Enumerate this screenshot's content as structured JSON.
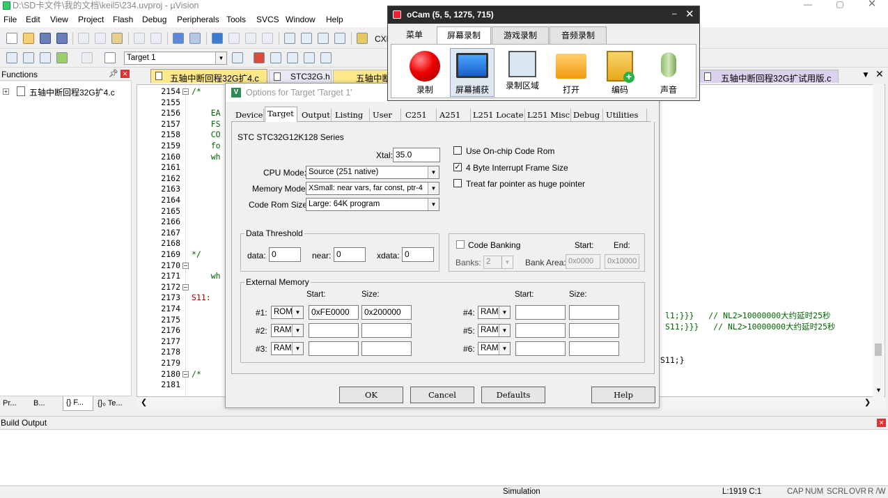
{
  "window": {
    "title": "D:\\SD卡文件\\我的文档\\keil5\\234.uvproj - µVision"
  },
  "menu": [
    "File",
    "Edit",
    "View",
    "Project",
    "Flash",
    "Debug",
    "Peripherals",
    "Tools",
    "SVCS",
    "Window",
    "Help"
  ],
  "toolbar": {
    "cxf": "CXF",
    "target_select": "Target 1"
  },
  "functions_panel": {
    "title": "Functions",
    "tree_item": "五轴中断回程32G扩4.c",
    "bottom_tabs": [
      "Pr...",
      "B...",
      "{} F...",
      "{}₀ Te..."
    ]
  },
  "editor_tabs": [
    "五轴中断回程32G扩4.c",
    "STC32G.h",
    "五轴中断",
    "五轴中断回程32G扩试用版.c"
  ],
  "code_lines": [
    {
      "n": "2154",
      "t": "/*",
      "c": false
    },
    {
      "n": "2155",
      "t": "",
      "c": false
    },
    {
      "n": "2156",
      "t": "    EA",
      "c": false
    },
    {
      "n": "2157",
      "t": "    FS",
      "c": false
    },
    {
      "n": "2158",
      "t": "    CO",
      "c": false
    },
    {
      "n": "2159",
      "t": "    fo",
      "c": false
    },
    {
      "n": "2160",
      "t": "    wh",
      "c": false
    },
    {
      "n": "2161",
      "t": "",
      "c": false
    },
    {
      "n": "2162",
      "t": "",
      "c": false
    },
    {
      "n": "2163",
      "t": "",
      "c": false
    },
    {
      "n": "2164",
      "t": "",
      "c": false
    },
    {
      "n": "2165",
      "t": "",
      "c": false
    },
    {
      "n": "2166",
      "t": "",
      "c": false
    },
    {
      "n": "2167",
      "t": "",
      "c": false
    },
    {
      "n": "2168",
      "t": "",
      "c": false
    },
    {
      "n": "2169",
      "t": "*/",
      "c": false
    },
    {
      "n": "2170",
      "t": "",
      "c": false
    },
    {
      "n": "2171",
      "t": "    wh",
      "c": false
    },
    {
      "n": "2172",
      "t": "",
      "c": false
    },
    {
      "n": "2173",
      "t": "S11:",
      "c": false
    },
    {
      "n": "2174",
      "t": "",
      "c": false
    },
    {
      "n": "2175",
      "t": "",
      "c": false
    },
    {
      "n": "2176",
      "t": "",
      "c": false
    },
    {
      "n": "2177",
      "t": "",
      "c": false
    },
    {
      "n": "2178",
      "t": "",
      "c": false
    },
    {
      "n": "2179",
      "t": "",
      "c": false
    },
    {
      "n": "2180",
      "t": "/*",
      "c": false
    },
    {
      "n": "2181",
      "t": "",
      "c": false
    }
  ],
  "code_right": [
    "l1;}}}   // NL2>10000000大约延时25秒",
    "S11;}}}   // NL2>10000000大约延时25秒",
    "S11;}"
  ],
  "build_output": {
    "title": "Build Output"
  },
  "status": {
    "mode": "Simulation",
    "pos": "L:1919 C:1",
    "caps": "CAP",
    "num": "NUM",
    "scrl": "SCRL",
    "ovr": "OVR",
    "rw": "R /W"
  },
  "dialog": {
    "title": "Options for Target 'Target 1'",
    "tabs": [
      "Device",
      "Target",
      "Output",
      "Listing",
      "User",
      "C251",
      "A251",
      "L251 Locate",
      "L251 Misc",
      "Debug",
      "Utilities"
    ],
    "device": "STC STC32G12K128 Series",
    "xtal_label": "Xtal:",
    "xtal": "35.0",
    "cpu_mode_label": "CPU Mode:",
    "cpu_mode": "Source (251 native)",
    "memory_model_label": "Memory Model:",
    "memory_model": "XSmall: near vars, far const, ptr-4",
    "code_rom_label": "Code Rom Size:",
    "code_rom": "Large: 64K program",
    "opt_onchip": "Use On-chip Code Rom",
    "opt_4byte": "4 Byte Interrupt Frame Size",
    "opt_far": "Treat far pointer as huge pointer",
    "data_threshold": {
      "legend": "Data Threshold",
      "data_label": "data:",
      "data": "0",
      "near_label": "near:",
      "near": "0",
      "xdata_label": "xdata:",
      "xdata": "0"
    },
    "banking": {
      "label": "Code Banking",
      "banks_label": "Banks:",
      "banks": "2",
      "area_label": "Bank Area:",
      "start_label": "Start:",
      "end_label": "End:",
      "start": "0x0000",
      "end": "0x10000"
    },
    "ext": {
      "legend": "External Memory",
      "start_label": "Start:",
      "size_label": "Size:",
      "rows_left": [
        {
          "id": "#1:",
          "type": "ROM",
          "start": "0xFE0000",
          "size": "0x200000"
        },
        {
          "id": "#2:",
          "type": "RAM",
          "start": "",
          "size": ""
        },
        {
          "id": "#3:",
          "type": "RAM",
          "start": "",
          "size": ""
        }
      ],
      "rows_right": [
        {
          "id": "#4:",
          "type": "RAM",
          "start": "",
          "size": ""
        },
        {
          "id": "#5:",
          "type": "RAM",
          "start": "",
          "size": ""
        },
        {
          "id": "#6:",
          "type": "RAM",
          "start": "",
          "size": ""
        }
      ]
    },
    "buttons": {
      "ok": "OK",
      "cancel": "Cancel",
      "defaults": "Defaults",
      "help": "Help"
    }
  },
  "ocam": {
    "title": "oCam (5, 5, 1275, 715)",
    "tabs": [
      "菜单",
      "屏幕录制",
      "游戏录制",
      "音频录制"
    ],
    "buttons": [
      {
        "label": "录制",
        "icon": "record-icon"
      },
      {
        "label": "屏幕捕获",
        "icon": "screen-capture-icon"
      },
      {
        "label": "录制区域",
        "icon": "record-area-icon"
      },
      {
        "label": "打开",
        "icon": "open-folder-icon"
      },
      {
        "label": "编码",
        "icon": "codec-icon"
      },
      {
        "label": "声音",
        "icon": "microphone-icon"
      }
    ]
  }
}
